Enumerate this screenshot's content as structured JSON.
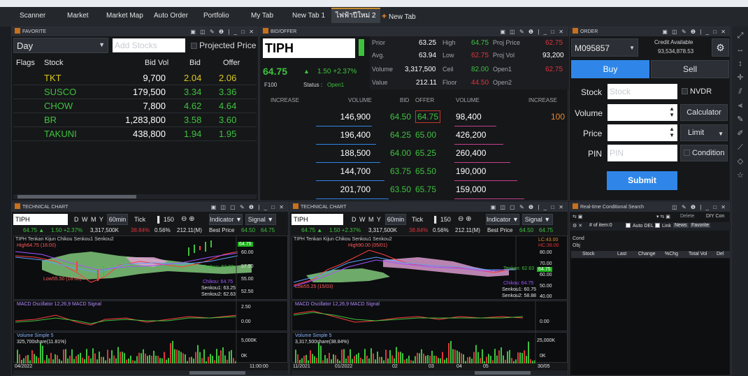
{
  "tabs": [
    {
      "label": "Scanner",
      "active": false
    },
    {
      "label": "Market",
      "active": false
    },
    {
      "label": "Market Map",
      "active": false
    },
    {
      "label": "Auto Order",
      "active": false
    },
    {
      "label": "Portfolio",
      "active": false
    },
    {
      "label": "My Tab",
      "active": false
    },
    {
      "label": "New Tab 1",
      "active": false
    },
    {
      "label": "ไฟฟ้าปีใหม่ 2",
      "active": true
    }
  ],
  "new_tab_label": "New Tab",
  "favorite": {
    "header": "FAVORITE",
    "group": "Day",
    "add_placeholder": "Add Stocks",
    "projected_label": "Projected Price",
    "columns": [
      "Flags",
      "Stock",
      "Bid Vol",
      "Bid",
      "Offer"
    ],
    "rows": [
      {
        "stock": "TKT",
        "bidvol": "9,700",
        "bid": "2.04",
        "offer": "2.06",
        "color": "yellow"
      },
      {
        "stock": "SUSCO",
        "bidvol": "179,500",
        "bid": "3.34",
        "offer": "3.36",
        "color": "green"
      },
      {
        "stock": "CHOW",
        "bidvol": "7,800",
        "bid": "4.62",
        "offer": "4.64",
        "color": "green"
      },
      {
        "stock": "BR",
        "bidvol": "1,283,800",
        "bid": "3.58",
        "offer": "3.60",
        "color": "green"
      },
      {
        "stock": "TAKUNI",
        "bidvol": "438,800",
        "bid": "1.94",
        "offer": "1.95",
        "color": "green"
      }
    ]
  },
  "bidoffer": {
    "header": "BID/OFFER",
    "symbol": "TIPH",
    "last": "64.75",
    "arrow": "▲",
    "change": "1.50 +2.37%",
    "board": "F100",
    "status_label": "Status :",
    "status_value": "Open1",
    "stats": {
      "prior_label": "Prior",
      "prior": "63.25",
      "high_label": "High",
      "high": "64.75",
      "projprice_label": "Proj Price",
      "projprice": "62.75",
      "avg_label": "Avg.",
      "avg": "63.94",
      "low_label": "Low",
      "low": "62.75",
      "projvol_label": "Proj Vol",
      "projvol": "93,200",
      "volume_label": "Volume",
      "volume": "3,317,500",
      "ceil_label": "Ceil",
      "ceil": "82.00",
      "open1_label": "Open1",
      "open1": "62.75",
      "value_label": "Value",
      "value": "212.11",
      "floor_label": "Floor",
      "floor": "44.50",
      "open2_label": "Open2"
    },
    "columns": [
      "INCREASE",
      "VOLUME",
      "BID",
      "OFFER",
      "VOLUME",
      "INCREASE"
    ],
    "rows": [
      {
        "bidvol": "146,900",
        "bid": "64.50",
        "offer": "64.75",
        "offervol": "98,400",
        "incr": "100"
      },
      {
        "bidvol": "196,400",
        "bid": "64.25",
        "offer": "65.00",
        "offervol": "426,200",
        "incr": ""
      },
      {
        "bidvol": "188,500",
        "bid": "64.00",
        "offer": "65.25",
        "offervol": "260,400",
        "incr": ""
      },
      {
        "bidvol": "144,700",
        "bid": "63.75",
        "offer": "65.50",
        "offervol": "190,000",
        "incr": ""
      },
      {
        "bidvol": "201,700",
        "bid": "63.50",
        "offer": "65.75",
        "offervol": "159,000",
        "incr": ""
      }
    ]
  },
  "order": {
    "header": "ORDER",
    "account": "M095857",
    "credit_label": "Credit Available",
    "credit_value": "93,534,878.53",
    "buy_label": "Buy",
    "sell_label": "Sell",
    "stock_label": "Stock",
    "stock_placeholder": "Stock",
    "nvdr_label": "NVDR",
    "volume_label": "Volume",
    "calculator_label": "Calculator",
    "price_label": "Price",
    "limit_label": "Limit",
    "pin_label": "PIN",
    "pin_placeholder": "PIN",
    "condition_label": "Condition",
    "submit_label": "Submit"
  },
  "chart1": {
    "header": "TECHNICAL CHART",
    "symbol": "TIPH",
    "periods": [
      "D",
      "W",
      "M",
      "Y"
    ],
    "interval": "60min",
    "tick": "Tick",
    "bars": "150",
    "indicator": "Indicator ▼",
    "signal": "Signal ▼",
    "info_last": "64.75 ▲",
    "info_chg": "1.50 +2.37%",
    "info_vol": "3,317,500K",
    "info_pct": "38.84%",
    "info_pct2": "0.56%",
    "info_val": "212.11(M)",
    "best_label": "Best Price",
    "best_bid": "64.50",
    "best_offer": "64.75",
    "ichimoku": "TIPH  Tenkan  Kijun  Chikou  Senkou1  Senkou2",
    "high_note": "High64.75 (16:00)",
    "low_note": "Low55.50 (16:00)",
    "yticks": [
      "60.00",
      "57.50",
      "55.00",
      "52.50"
    ],
    "tenkan": "Tenkan: 63.63",
    "chikou": "Chikou: 64.75",
    "senkou1": "Senkou1: 63.25",
    "senkou2": "Senkou2: 62.63",
    "price_badge": "64.75",
    "macd_label": "MACD Oscillator 12,26,9  MACD  Signal",
    "macd_ticks": [
      "2.50",
      "0.00"
    ],
    "vol_label": "Volume  Simple 5",
    "vol_sub": "325,700share(11.81%)",
    "vol_ticks": [
      "5,000K",
      "0K"
    ],
    "x_start": "04/2022",
    "x_end": "11:00:00"
  },
  "chart2": {
    "header": "TECHNICAL CHART",
    "symbol": "TIPH",
    "periods": [
      "D",
      "W",
      "M",
      "Y"
    ],
    "interval": "60min",
    "tick": "Tick",
    "bars": "150",
    "indicator": "Indicator ▼",
    "signal": "Signal ▼",
    "info_last": "64.75 ▲",
    "info_chg": "1.50 +2.37%",
    "info_vol": "3,317,500K",
    "info_pct": "38.84%",
    "info_pct2": "0.56%",
    "info_val": "212.11(M)",
    "best_label": "Best Price",
    "best_bid": "64.50",
    "best_offer": "64.75",
    "ichimoku": "TIPH  Tenkan  Kijun  Chikou  Senkou1  Senkou2",
    "high_note": "High90.00 (05/01)",
    "low_note": "Low55.25 (15/03)",
    "yticks": [
      "80.00",
      "70.00",
      "60.00",
      "50.00",
      "40.00"
    ],
    "tenkan": "Tenkan: 62.63",
    "chikou": "Chikou: 64.75",
    "senkou1": "Senkou1: 60.75",
    "senkou2": "Senkou2: 58.88",
    "price_badge": "64.75",
    "lc": "LC:43.00",
    "hc": "HC:38.00",
    "macd_label": "MACD Oscillator 12,26,9  MACD  Signal",
    "macd_ticks": [
      "0.00"
    ],
    "vol_label": "Volume  Simple 5",
    "vol_sub": "3,317,500share(38.84%)",
    "vol_ticks": [
      "25,000K",
      "0K"
    ],
    "x_labels": [
      "11/2021",
      "01/2022",
      "02",
      "03",
      "04",
      "05",
      "30/05"
    ]
  },
  "rtcs": {
    "header": "Real-time Conditional Search",
    "item_label": "# of item:0",
    "autodel": "Auto DEL",
    "link": "Link",
    "news": "News",
    "favorite": "Favorite",
    "delete": "Delete",
    "diy": "DIY Con",
    "cond": "Cond",
    "obj": "Obj",
    "columns": [
      "Stock",
      "Last",
      "Change",
      "%Chg",
      "Total Vol",
      "Del"
    ]
  },
  "colors": {
    "accent": "#c98b2c",
    "buy": "#2f86e8",
    "up": "#3ec23e",
    "down": "#e0343b",
    "neutral": "#d8c81f"
  }
}
